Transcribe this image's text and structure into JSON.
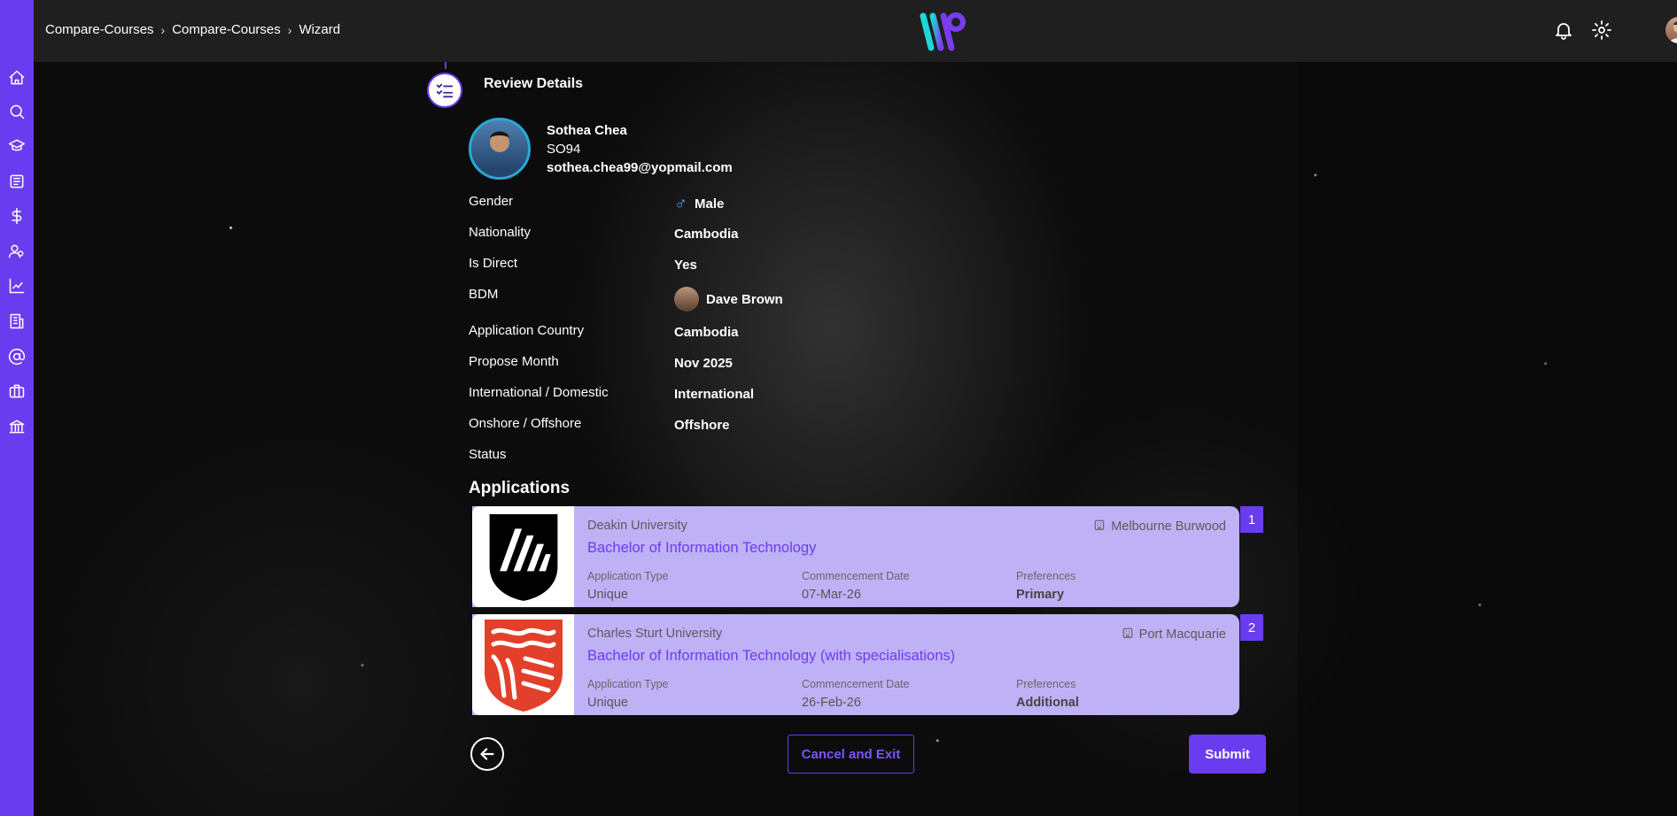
{
  "breadcrumb": [
    "Compare-Courses",
    "Compare-Courses",
    "Wizard"
  ],
  "step": {
    "title": "Review Details"
  },
  "student": {
    "name": "Sothea Chea",
    "code": "SO94",
    "email": "sothea.chea99@yopmail.com"
  },
  "fields": [
    {
      "label": "Gender",
      "value": "Male",
      "icon": "male-icon"
    },
    {
      "label": "Nationality",
      "value": "Cambodia"
    },
    {
      "label": "Is Direct",
      "value": "Yes"
    },
    {
      "label": "BDM",
      "value": "Dave Brown",
      "icon": "avatar"
    },
    {
      "label": "Application Country",
      "value": "Cambodia"
    },
    {
      "label": "Propose Month",
      "value": "Nov 2025"
    },
    {
      "label": "International / Domestic",
      "value": "International"
    },
    {
      "label": "Onshore / Offshore",
      "value": "Offshore"
    },
    {
      "label": "Status",
      "value": ""
    }
  ],
  "applications_title": "Applications",
  "applications": [
    {
      "number": "1",
      "university": "Deakin University",
      "location": "Melbourne Burwood",
      "course": "Bachelor of Information Technology",
      "type_label": "Application Type",
      "type": "Unique",
      "date_label": "Commencement Date",
      "date": "07-Mar-26",
      "pref_label": "Preferences",
      "preference": "Primary"
    },
    {
      "number": "2",
      "university": "Charles Sturt University",
      "location": "Port Macquarie",
      "course": "Bachelor of Information Technology (with specialisations)",
      "type_label": "Application Type",
      "type": "Unique",
      "date_label": "Commencement Date",
      "date": "26-Feb-26",
      "pref_label": "Preferences",
      "preference": "Additional"
    }
  ],
  "buttons": {
    "cancel": "Cancel and Exit",
    "submit": "Submit"
  },
  "colors": {
    "accent": "#6a3cf0",
    "card": "#bfb1f6",
    "topbar": "#1f1f20"
  },
  "sidebar_icons": [
    "home-icon",
    "search-icon",
    "graduation-cap-icon",
    "newspaper-icon",
    "dollar-icon",
    "users-icon",
    "chart-icon",
    "building-icon",
    "at-icon",
    "briefcase-icon",
    "bank-icon"
  ]
}
